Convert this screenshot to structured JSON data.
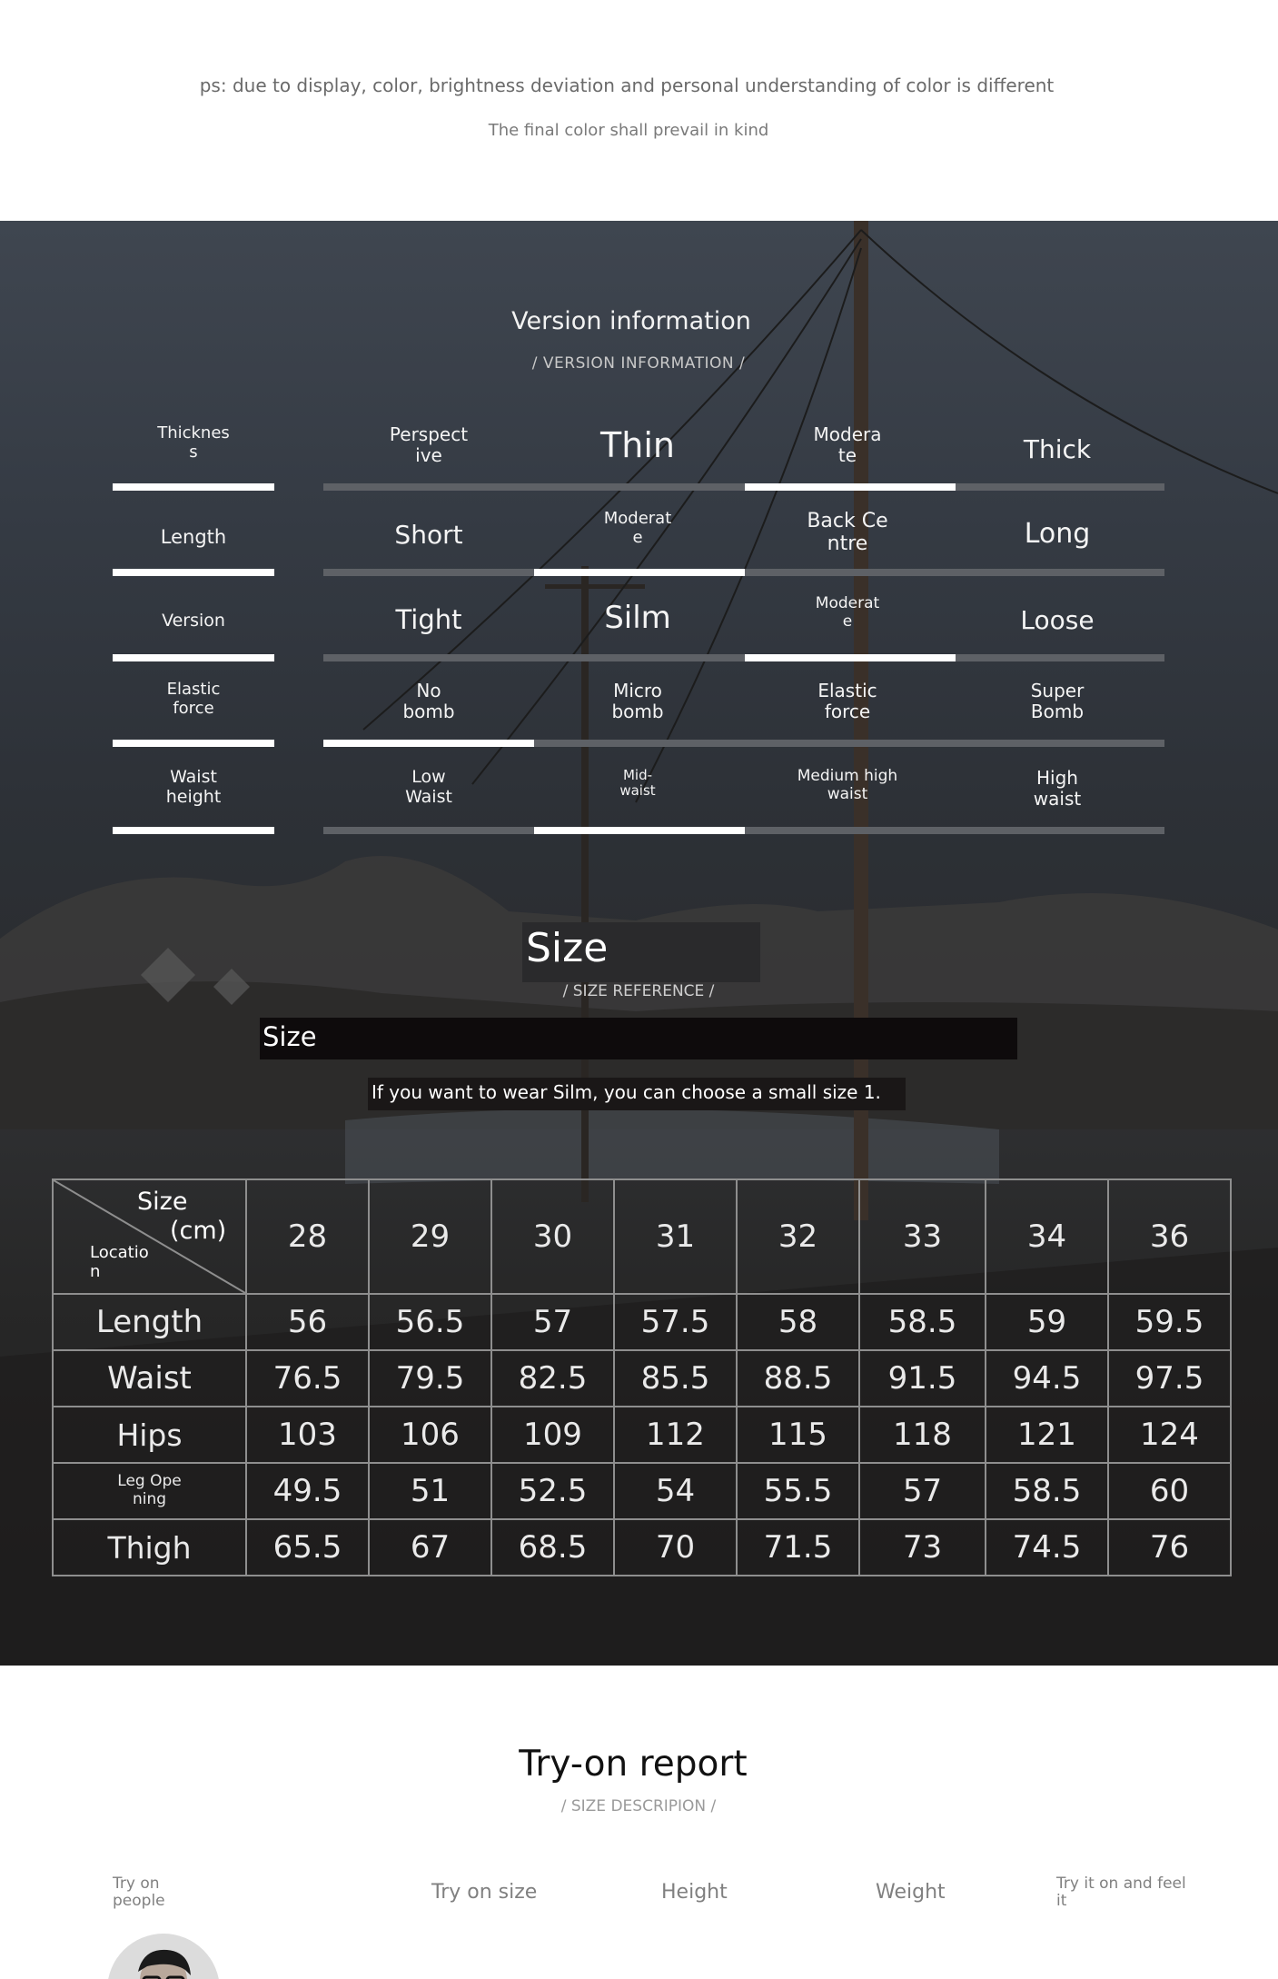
{
  "notice": {
    "line1": "ps: due to display, color, brightness deviation and personal understanding of color is different",
    "line2": "The final color shall prevail in kind"
  },
  "version": {
    "title": "Version information",
    "subtitle": "/ VERSION INFORMATION /",
    "rows": [
      {
        "name": "Thicknes\ns",
        "options": [
          "Perspect\nive",
          "Thin",
          "Modera\nte",
          "Thick"
        ],
        "selected": 3
      },
      {
        "name": "Length",
        "options": [
          "Short",
          "Moderat\ne",
          "Back Ce\nntre",
          "Long"
        ],
        "selected": 2
      },
      {
        "name": "Version",
        "options": [
          "Tight",
          "Silm",
          "Moderat\ne",
          "Loose"
        ],
        "selected": 3
      },
      {
        "name": "Elastic\nforce",
        "options": [
          "No\nbomb",
          "Micro\nbomb",
          "Elastic\nforce",
          "Super\nBomb"
        ],
        "selected": 1
      },
      {
        "name": "Waist\nheight",
        "options": [
          "Low\nWaist",
          "Mid-\nwaist",
          "Medium high\nwaist",
          "High\nwaist"
        ],
        "selected": 2
      }
    ]
  },
  "size": {
    "title": "Size",
    "subtitle": "/ SIZE REFERENCE /",
    "band_label": "Size",
    "tip": "If you want to wear Silm, you can choose a small size 1.",
    "corner": {
      "size": "Size",
      "unit": "(cm)",
      "location": "Locatio\nn"
    },
    "columns": [
      "28",
      "29",
      "30",
      "31",
      "32",
      "33",
      "34",
      "36"
    ],
    "rows": [
      {
        "label": "Length",
        "values": [
          "56",
          "56.5",
          "57",
          "57.5",
          "58",
          "58.5",
          "59",
          "59.5"
        ]
      },
      {
        "label": "Waist",
        "values": [
          "76.5",
          "79.5",
          "82.5",
          "85.5",
          "88.5",
          "91.5",
          "94.5",
          "97.5"
        ]
      },
      {
        "label": "Hips",
        "values": [
          "103",
          "106",
          "109",
          "112",
          "115",
          "118",
          "121",
          "124"
        ]
      },
      {
        "label": "Leg Ope\nning",
        "values": [
          "49.5",
          "51",
          "52.5",
          "54",
          "55.5",
          "57",
          "58.5",
          "60"
        ]
      },
      {
        "label": "Thigh",
        "values": [
          "65.5",
          "67",
          "68.5",
          "70",
          "71.5",
          "73",
          "74.5",
          "76"
        ]
      }
    ]
  },
  "tryon": {
    "title": "Try-on report",
    "subtitle": "/ SIZE DESCRIPION /",
    "headers": [
      "Try on\npeople",
      "Try on size",
      "Height",
      "Weight",
      "Try it on and feel\nit"
    ]
  }
}
